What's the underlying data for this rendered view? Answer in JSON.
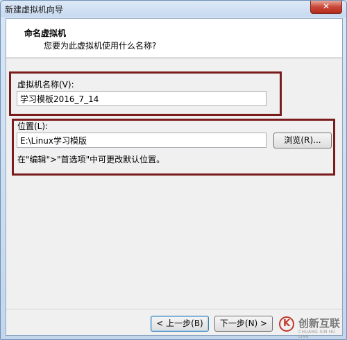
{
  "window": {
    "title": "新建虚拟机向导",
    "close_glyph": "✕"
  },
  "header": {
    "title": "命名虚拟机",
    "subtitle": "您要为此虚拟机使用什么名称?"
  },
  "vm_name": {
    "label": "虚拟机名称(V):",
    "value": "学习模板2016_7_14"
  },
  "location": {
    "label": "位置(L):",
    "value": "E:\\Linux学习模版",
    "browse_label": "浏览(R)...",
    "hint": "在\"编辑\">\"首选项\"中可更改默认位置。"
  },
  "footer": {
    "back_label": "< 上一步(B)",
    "next_label": "下一步(N) >"
  },
  "watermark": {
    "logo_glyph": "K",
    "name": "创新互联",
    "sub": "CHUANG XIN HU LIAN"
  },
  "colors": {
    "highlight_border": "#7a1c1c",
    "close_button": "#c9483a"
  }
}
